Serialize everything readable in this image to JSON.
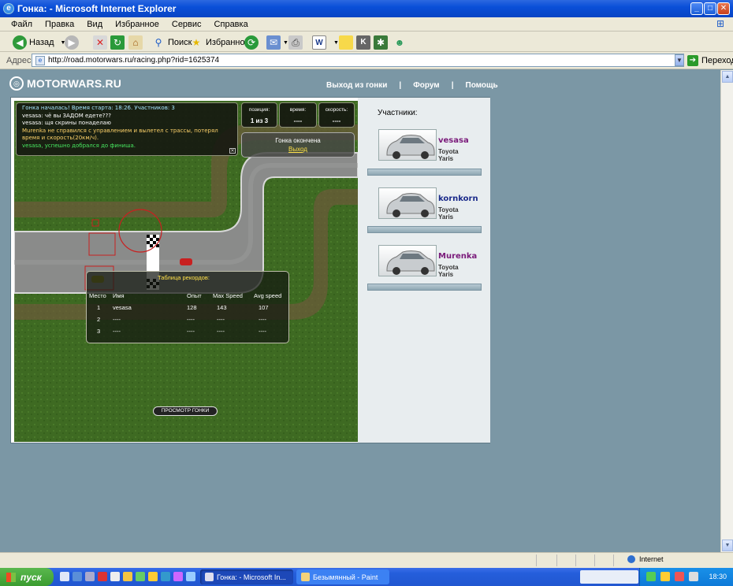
{
  "window": {
    "title": "Гонка: - Microsoft Internet Explorer",
    "min": "_",
    "max": "□",
    "close": "✕"
  },
  "menu": [
    "Файл",
    "Правка",
    "Вид",
    "Избранное",
    "Сервис",
    "Справка"
  ],
  "toolbar": {
    "back": "Назад",
    "search": "Поиск",
    "favorites": "Избранное"
  },
  "address": {
    "label": "Адрес:",
    "url": "http://road.motorwars.ru/racing.php?rid=1625374",
    "go": "Переход"
  },
  "site": {
    "logo": "MOTORWARS.RU",
    "nav": [
      "Выход из гонки",
      "Форум",
      "Помощь"
    ],
    "nav_sep": "|"
  },
  "game": {
    "chat": [
      {
        "text": "Гонка началась! Время старта: 18:26. Участников: 3",
        "kind": "sys"
      },
      {
        "text": "vesasa: чё вы ЗАДОМ едете???",
        "kind": "msg"
      },
      {
        "text": "vesasa: щя скрины понаделаю",
        "kind": "msg"
      },
      {
        "text": "Murenka не справился с управлением и вылетел с трассы, потерял",
        "kind": "warn"
      },
      {
        "text": "время и скорость(20км/ч).",
        "kind": "warn"
      },
      {
        "text": "vesasa, успешно добрался до финиша.",
        "kind": "ok"
      }
    ],
    "stats": [
      {
        "label": "позиция:",
        "value": "1 из 3"
      },
      {
        "label": "время:",
        "value": "----"
      },
      {
        "label": "скорость:",
        "value": "----"
      }
    ],
    "finish": {
      "text": "Гонка окончена",
      "exit": "Выход"
    },
    "records": {
      "title": "Таблица рекордов:",
      "headers": [
        "Место",
        "Имя",
        "Опыт",
        "Max Speed",
        "Avg speed"
      ],
      "rows": [
        [
          "1",
          "vesasa",
          "128",
          "143",
          "107"
        ],
        [
          "2",
          "----",
          "----",
          "----",
          "----"
        ],
        [
          "3",
          "----",
          "----",
          "----",
          "----"
        ]
      ]
    },
    "replay": "ПРОСМОТР ГОНКИ"
  },
  "participants": {
    "title": "Участники:",
    "list": [
      {
        "name": "vesasa",
        "car": "Toyota Yaris",
        "color": "#7a1a7a"
      },
      {
        "name": "kornkorn",
        "car": "Toyota Yaris",
        "color": "#1a2a8a"
      },
      {
        "name": "Murenka",
        "car": "Toyota Yaris",
        "color": "#7a1a7a"
      }
    ]
  },
  "status": {
    "zone": "Internet"
  },
  "taskbar": {
    "start": "пуск",
    "tasks": [
      "Гонка: - Microsoft In...",
      "Безымянный - Paint"
    ],
    "clock": "18:30"
  }
}
